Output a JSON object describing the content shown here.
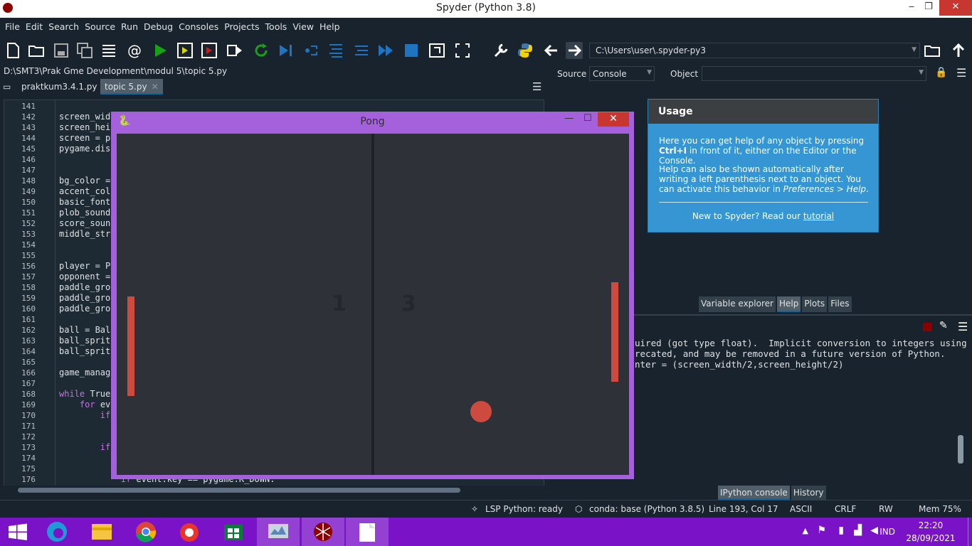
{
  "window": {
    "title": "Spyder (Python 3.8)",
    "minimize": "‒",
    "restore": "❐",
    "close": "✕"
  },
  "menu": [
    "File",
    "Edit",
    "Search",
    "Source",
    "Run",
    "Debug",
    "Consoles",
    "Projects",
    "Tools",
    "View",
    "Help"
  ],
  "toolbar": {
    "path": "C:\\Users\\user\\.spyder-py3"
  },
  "editor": {
    "file_path": "D:\\SMT3\\Prak Gme Development\\modul 5\\topic 5.py",
    "tabs": [
      {
        "label": "praktkum3.4.1.py"
      },
      {
        "label": "topic 5.py"
      }
    ],
    "lines": [
      {
        "n": "141",
        "code": ""
      },
      {
        "n": "142",
        "code": "screen_widt"
      },
      {
        "n": "143",
        "code": "screen_heig"
      },
      {
        "n": "144",
        "code": "screen = py"
      },
      {
        "n": "145",
        "code": "pygame.disp"
      },
      {
        "n": "146",
        "code": ""
      },
      {
        "n": "147",
        "code": ""
      },
      {
        "n": "148",
        "code": "bg_color = "
      },
      {
        "n": "149",
        "code": "accent_colo"
      },
      {
        "n": "150",
        "code": "basic_font "
      },
      {
        "n": "151",
        "code": "plob_sound "
      },
      {
        "n": "152",
        "code": "score_sound"
      },
      {
        "n": "153",
        "code": "middle_stri"
      },
      {
        "n": "154",
        "code": ""
      },
      {
        "n": "155",
        "code": ""
      },
      {
        "n": "156",
        "code": "player = Pl"
      },
      {
        "n": "157",
        "code": "opponent = "
      },
      {
        "n": "158",
        "code": "paddle_grou"
      },
      {
        "n": "159",
        "code": "paddle_grou"
      },
      {
        "n": "160",
        "code": "paddle_grou"
      },
      {
        "n": "161",
        "code": ""
      },
      {
        "n": "162",
        "code": "ball = Ball"
      },
      {
        "n": "163",
        "code": "ball_sprite"
      },
      {
        "n": "164",
        "code": "ball_sprite"
      },
      {
        "n": "165",
        "code": ""
      },
      {
        "n": "166",
        "code": "game_manage"
      },
      {
        "n": "167",
        "code": ""
      },
      {
        "n": "168",
        "code": "while True:"
      },
      {
        "n": "169",
        "code": "    for eve"
      },
      {
        "n": "170",
        "code": "        if"
      },
      {
        "n": "171",
        "code": ""
      },
      {
        "n": "172",
        "code": ""
      },
      {
        "n": "173",
        "code": "        if"
      },
      {
        "n": "174",
        "code": ""
      },
      {
        "n": "175",
        "code": ""
      },
      {
        "n": "176",
        "code": "            if event.key == pygame.K_DOWN:"
      }
    ]
  },
  "help": {
    "source_label": "Source",
    "source_value": "Console",
    "object_label": "Object",
    "object_value": "",
    "usage_title": "Usage",
    "para1_pre": "Here you can get help of any object by pressing ",
    "para1_key": "Ctrl+I",
    "para1_post": " in front of it, either on the Editor or the Console.",
    "para2_pre": "Help can also be shown automatically after writing a left parenthesis next to an object. You can activate this behavior in ",
    "para2_em": "Preferences > Help",
    "para2_post": ".",
    "new_pre": "New to Spyder? Read our ",
    "new_link": "tutorial",
    "tabs": [
      "Variable explorer",
      "Help",
      "Plots",
      "Files"
    ]
  },
  "console": {
    "lines": [
      "uired (got type float).  Implicit conversion to integers using",
      "recated, and may be removed in a future version of Python.",
      "nter = (screen_width/2,screen_height/2)"
    ],
    "tabs": [
      "IPython console",
      "History"
    ]
  },
  "pong": {
    "title": "Pong",
    "score_left": "1",
    "score_right": "3",
    "minimize": "—",
    "maximize": "☐",
    "close": "✕"
  },
  "status": {
    "lsp": "LSP Python: ready",
    "conda": "conda: base (Python 3.8.5)",
    "position": "Line 193, Col 17",
    "encoding": "ASCII",
    "eol": "CRLF",
    "rw": "RW",
    "mem": "Mem 75%"
  },
  "taskbar": {
    "lang": "IND",
    "time": "22:20",
    "date": "28/09/2021"
  },
  "colors": {
    "bg": "#19232d",
    "pong_border": "#a560dc",
    "pong_canvas": "#2e3138",
    "accent_red": "#cc4a3e",
    "help_blue": "#3596d3",
    "taskbar": "#7a12c8"
  }
}
